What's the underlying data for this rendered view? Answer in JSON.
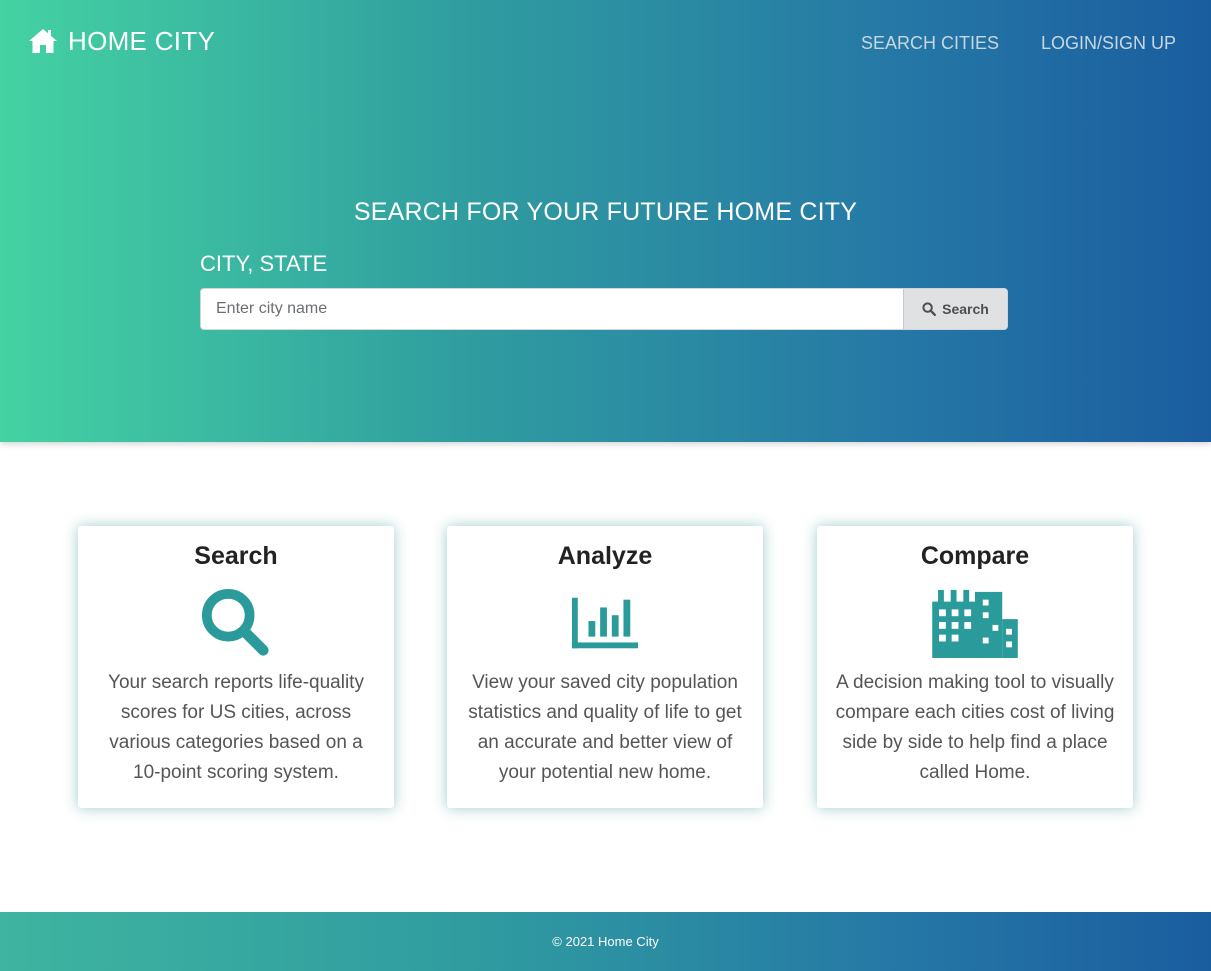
{
  "brand": {
    "name": "HOME CITY",
    "icon": "home-icon"
  },
  "nav": {
    "items": [
      {
        "label": "SEARCH CITIES"
      },
      {
        "label": "LOGIN/SIGN UP"
      }
    ]
  },
  "hero": {
    "title": "SEARCH FOR YOUR FUTURE HOME CITY",
    "field_label": "CITY, STATE",
    "search_placeholder": "Enter city name",
    "search_value": "",
    "search_button": "Search",
    "search_icon": "search-icon"
  },
  "cards": [
    {
      "title": "Search",
      "icon": "magnifier-icon",
      "description": "Your search reports life-quality scores for US cities, across various categories based on a 10-point scoring system."
    },
    {
      "title": "Analyze",
      "icon": "bar-chart-icon",
      "description": "View your saved city population statistics and quality of life to get an accurate and better view of your potential new home."
    },
    {
      "title": "Compare",
      "icon": "city-buildings-icon",
      "description": "A decision making tool to visually compare each cities cost of living side by side to help find a place called Home."
    }
  ],
  "footer": {
    "copyright": "© 2021 Home City"
  },
  "colors": {
    "gradient_start": "#44d2a2",
    "gradient_end": "#1a5d9f",
    "icon_teal": "#2a9b9a",
    "nav_text": "#c7d7e2",
    "card_shadow": "#2d8c8c"
  }
}
